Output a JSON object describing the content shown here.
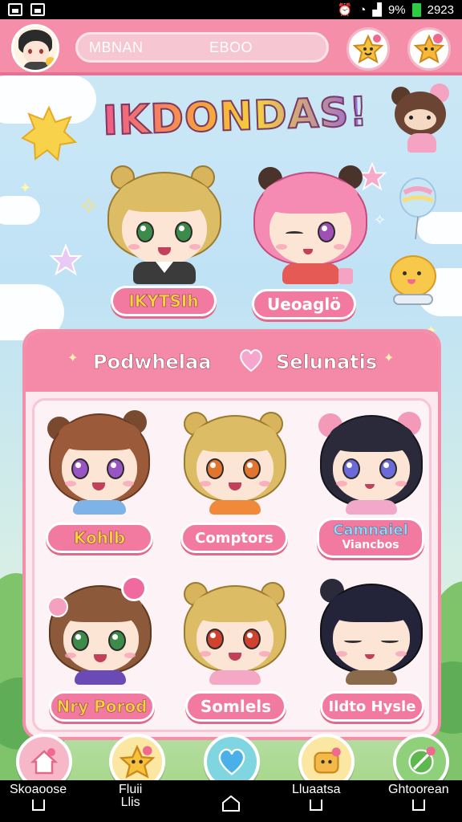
{
  "status_bar": {
    "signal": "9%",
    "time": "2923"
  },
  "header": {
    "search_left": "MBNAN",
    "search_right": "EBOO"
  },
  "title": "IKDONDAS!",
  "featured": [
    {
      "name": "IKYTSIh"
    },
    {
      "name": "Ueoaglö"
    }
  ],
  "panel": {
    "left_title": "Podwhelaa",
    "right_title": "Selunatis",
    "characters": [
      {
        "name": "Kohlb"
      },
      {
        "name": "Comptors"
      },
      {
        "name": "Camnaiel",
        "subtitle": "Viancbos"
      },
      {
        "name": "Nry Porod"
      },
      {
        "name": "Somlels"
      },
      {
        "name": "Ildto Hysle"
      }
    ]
  },
  "android_nav": {
    "item1": "Skoaoose",
    "item2_line1": "Fluii",
    "item2_line2": "Llis",
    "item3": "Lluaatsa",
    "item4": "Ghtoorean"
  }
}
